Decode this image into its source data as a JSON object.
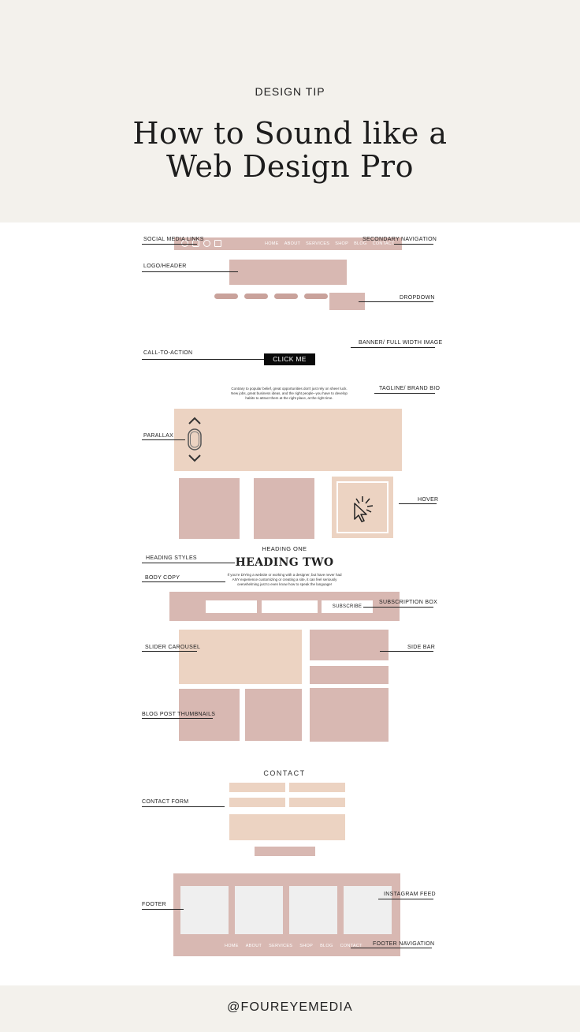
{
  "header": {
    "kicker": "DESIGN TIP",
    "title_line1": "How to Sound like a",
    "title_line2": "Web Design Pro"
  },
  "labels": {
    "social_media_links": "SOCIAL MEDIA LINKS",
    "secondary_navigation": "SECONDARY NAVIGATION",
    "logo_header": "LOGO/HEADER",
    "dropdown": "DROPDOWN",
    "banner": "BANNER/ FULL WIDTH IMAGE",
    "call_to_action": "CALL-TO-ACTION",
    "tagline": "TAGLINE/ BRAND BIO",
    "parallax": "PARALLAX",
    "hover": "HOVER",
    "heading_styles": "HEADING STYLES",
    "body_copy": "BODY COPY",
    "subscription_box": "SUBSCRIPTION BOX",
    "slider_carousel": "SLIDER CAROUSEL",
    "side_bar": "SIDE BAR",
    "blog_post_thumbnails": "BLOG POST THUMBNAILS",
    "contact_form": "CONTACT FORM",
    "footer": "FOOTER",
    "instagram_feed": "INSTAGRAM FEED",
    "footer_navigation": "FOOTER NAVIGATION"
  },
  "mockup": {
    "nav_items": [
      "HOME",
      "ABOUT",
      "SERVICES",
      "SHOP",
      "BLOG",
      "CONTACT"
    ],
    "cta_button": "CLICK ME",
    "tagline_text": "Contrary to popular belief, great opportunities don't just rely on sheer luck. New jobs, great business ideas, and the right people--you have to develop habits to attract them at the right place, at the right time.",
    "heading_one": "HEADING ONE",
    "heading_two": "HEADING TWO",
    "body_text": "If you're DIYing a website or working with a designer, but have never had ANY experience customizing or creating a site, it can feel seriously overwhelming just to even know how to speak the language!",
    "subscribe_button": "SUBSCRIBE",
    "contact_heading": "CONTACT",
    "footer_nav": [
      "HOME",
      "ABOUT",
      "SERVICES",
      "SHOP",
      "BLOG",
      "CONTACT"
    ],
    "social_icons": [
      "facebook-icon",
      "instagram-icon",
      "pinterest-icon",
      "tiktok-icon"
    ]
  },
  "footer": {
    "handle": "@FOUREYEMEDIA"
  },
  "colors": {
    "rose": "#d8b8b2",
    "peach": "#ecd3c2",
    "band": "#f3f1ec",
    "ink": "#222222"
  }
}
